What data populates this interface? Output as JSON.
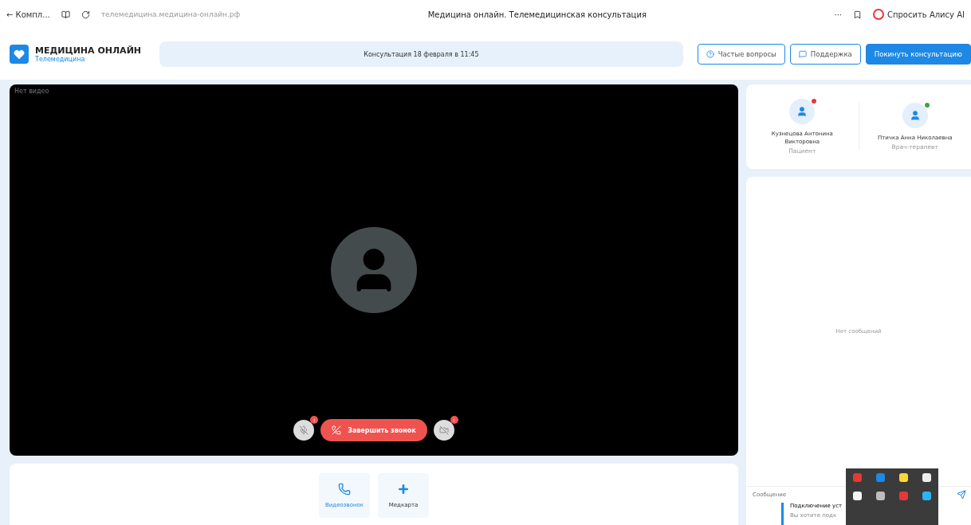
{
  "browser": {
    "back_label": "← Компл...",
    "url": "телемедицина.медицина-онлайн.рф",
    "title": "Медицина онлайн. Телемедицинская консультация",
    "more": "···",
    "assistant": "Спросить Алису AI"
  },
  "header": {
    "logo_title": "МЕДИЦИНА ОНЛАЙН",
    "logo_subtitle": "Телемедицина",
    "consultation": "Консультация 18 февраля в 11:45",
    "buttons": [
      {
        "label": "Частые вопросы",
        "kind": "help"
      },
      {
        "label": "Поддержка",
        "kind": "support"
      },
      {
        "label": "Покинуть консультацию",
        "kind": "leave"
      }
    ]
  },
  "video": {
    "status": "Нет видео",
    "controls": [
      {
        "kind": "mic",
        "badge": "!"
      },
      {
        "kind": "end",
        "label": "Завершить звонок"
      },
      {
        "kind": "camera",
        "badge": "!"
      }
    ]
  },
  "actions": [
    {
      "label": "Видеозвонок",
      "kind": "call",
      "selected": true
    },
    {
      "label": "Медкарта",
      "kind": "record",
      "selected": false
    }
  ],
  "participants": [
    {
      "name": "Кузнецова Антонина Викторовна",
      "role": "Пациент",
      "color": "#e53935"
    },
    {
      "name": "Птичка Анна Николаевна",
      "role": "Врач-терапевт",
      "color": "#43a047"
    }
  ],
  "chat": {
    "empty": "Нет сообщений",
    "placeholder": "Сообщение",
    "notification_title": "Подключение уст",
    "notification_text": "Вы хотите подк"
  },
  "tray": {
    "icons": [
      {
        "color": "#e53935"
      },
      {
        "color": "#1e88e5"
      },
      {
        "color": "#fdd835"
      },
      {
        "color": "#eeeeee"
      },
      {
        "color": "#f5f5f5"
      },
      {
        "color": "#bdbdbd"
      },
      {
        "color": "#e53935"
      },
      {
        "color": "#29b6f6"
      }
    ]
  }
}
